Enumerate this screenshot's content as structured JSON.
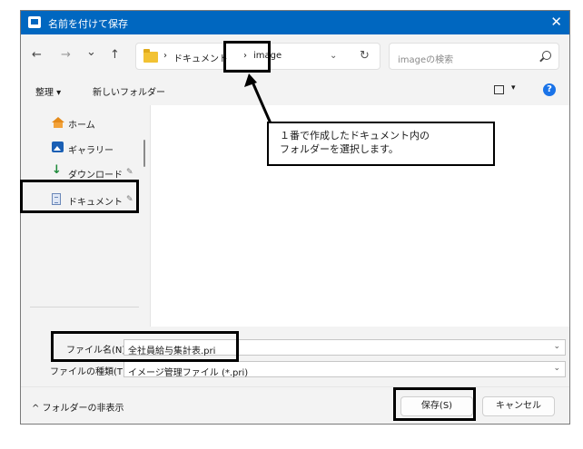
{
  "window": {
    "title": "名前を付けて保存",
    "close_glyph": "✕"
  },
  "nav": {
    "back_glyph": "←",
    "forward_glyph": "→",
    "recent_glyph": "⌄",
    "up_glyph": "↑"
  },
  "address": {
    "sep1": "›",
    "crumb_documents": "ドキュメント",
    "sep2": "›",
    "crumb_current": "image",
    "chevron": "⌄",
    "refresh_glyph": "↻"
  },
  "search": {
    "placeholder": "imageの検索"
  },
  "toolbar": {
    "organize": "整理 ▾",
    "new_folder": "新しいフォルダー",
    "view_caret": "▾",
    "help": "?"
  },
  "sidebar": {
    "items": [
      {
        "label": "ホーム",
        "icon": "home-icon"
      },
      {
        "label": "ギャラリー",
        "icon": "gallery-icon"
      },
      {
        "label": "ダウンロード",
        "icon": "download-icon",
        "pinned": true
      },
      {
        "label": "ドキュメント",
        "icon": "document-icon",
        "pinned": true
      }
    ],
    "download_glyph": "↓",
    "pin_glyph": "✎"
  },
  "form": {
    "filename_label": "ファイル名(N):",
    "filename_value": "全社員給与集計表.pri",
    "filetype_label": "ファイルの種類(T):",
    "filetype_value": "イメージ管理ファイル (*.pri)",
    "chevron": "⌄"
  },
  "footer": {
    "toggle_folders": "^ フォルダーの非表示",
    "save_button": "保存(S)",
    "cancel_button": "キャンセル"
  },
  "annotation": {
    "text": "１番で作成したドキュメント内の\nフォルダーを選択します。"
  },
  "colors": {
    "titlebar": "#0067c0",
    "highlight_border": "#000000",
    "help_icon": "#1a73e8"
  }
}
